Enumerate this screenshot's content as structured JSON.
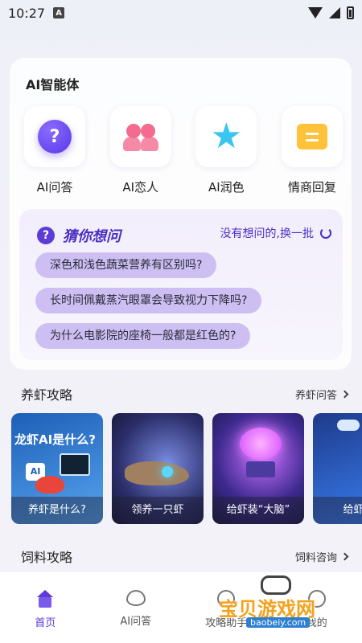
{
  "status_bar": {
    "time": "10:27",
    "badge": "A"
  },
  "agents_card": {
    "title": "AI智能体",
    "items": [
      {
        "label": "AI问答",
        "icon": "question-bubble-icon"
      },
      {
        "label": "AI恋人",
        "icon": "couple-icon"
      },
      {
        "label": "AI润色",
        "icon": "sparkle-star-icon"
      },
      {
        "label": "情商回复",
        "icon": "chat-box-icon"
      }
    ]
  },
  "guess": {
    "title": "猜你想问",
    "refresh_label": "没有想问的,换一批",
    "questions": [
      "深色和浅色蔬菜营养有区别吗?",
      "长时间佩戴蒸汽眼罩会导致视力下降吗?",
      "为什么电影院的座椅一般都是红色的?"
    ]
  },
  "shrimp_section": {
    "title": "养虾攻略",
    "more_label": "养虾问答",
    "banners": [
      {
        "caption": "养虾是什么?",
        "headline": "龙虾AI是什么?",
        "badge": "AI"
      },
      {
        "caption": "领养一只虾"
      },
      {
        "caption": "给虾装“大脑”"
      },
      {
        "caption": "给虾装"
      }
    ]
  },
  "feed_section": {
    "title": "饲料攻略",
    "more_label": "饲料咨询"
  },
  "bottom_nav": {
    "tabs": [
      {
        "label": "首页",
        "active": true
      },
      {
        "label": "AI问答"
      },
      {
        "label": "攻略助手"
      },
      {
        "label": "我的"
      }
    ]
  },
  "watermark": {
    "text": "宝贝游戏网",
    "url": "baobeiy.com"
  },
  "colors": {
    "accent": "#5c3bd6",
    "pill": "#cdbff2",
    "banner_caption_bg": "rgba(30,30,50,.45)"
  }
}
